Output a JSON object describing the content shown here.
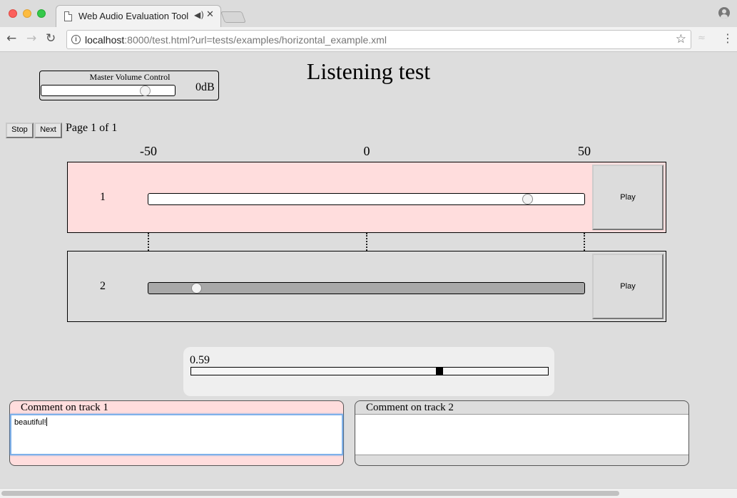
{
  "browser": {
    "tab_title": "Web Audio Evaluation Tool",
    "tab_close_glyph": "✕",
    "url_host": "localhost",
    "url_rest": ":8000/test.html?url=tests/examples/horizontal_example.xml",
    "icons": [
      "page-icon",
      "speaker-icon",
      "close-icon",
      "profile-icon",
      "back-icon",
      "forward-icon",
      "reload-icon",
      "info-icon",
      "star-icon",
      "extension-icon",
      "menu-icon"
    ]
  },
  "page": {
    "title": "Listening test",
    "master_volume": {
      "label": "Master Volume Control",
      "value_label": "0dB",
      "value_fraction": 0.8
    },
    "buttons": {
      "stop": "Stop",
      "next": "Next"
    },
    "page_counter": "Page 1 of 1",
    "scale_labels": [
      "-50",
      "0",
      "50"
    ],
    "tracks": [
      {
        "number": "1",
        "play_label": "Play",
        "slider_fraction": 0.88,
        "selected": true,
        "color": "#ffdddd"
      },
      {
        "number": "2",
        "play_label": "Play",
        "slider_fraction": 0.1,
        "selected": false,
        "color": "#dddddd"
      }
    ],
    "value_readout": {
      "text": "0.59",
      "fraction": 0.7
    },
    "comments": [
      {
        "label": "Comment on track 1",
        "text": "beautiful!"
      },
      {
        "label": "Comment on track 2",
        "text": ""
      }
    ]
  }
}
